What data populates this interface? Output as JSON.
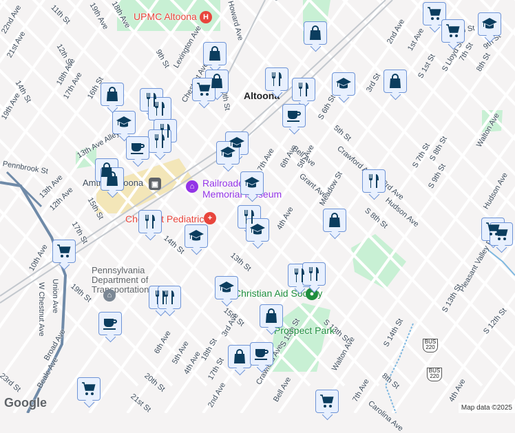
{
  "map": {
    "city_label": "Altoona",
    "pois": {
      "upmc": "UPMC Altoona",
      "railroad": "Railroaders Memorial Museum",
      "pediatrics": "Chestnut Pediatrics",
      "penndot": "Pennsylvania Department of Transportation...",
      "amtrak": "Amtrak Altoona",
      "aid": "Christian Aid Society",
      "park": "Prospect Park"
    },
    "streets": [
      "11th St",
      "19th Ave",
      "18th Ave",
      "Chestnut Ave",
      "Howard Ave",
      "9th St",
      "12th St",
      "21st Ave",
      "22nd Ave",
      "14th St",
      "18th Ave",
      "17th Ave",
      "16th St",
      "19th Ave",
      "Lexington Ave",
      "10th St",
      "Chestnut Ave",
      "13th Ave Alley",
      "Pennbrook St",
      "13th Ave",
      "12th Ave",
      "15th St",
      "17th St",
      "10th Ave",
      "14th St",
      "13th St",
      "19th St",
      "W Chestnut Ave",
      "Union Ave",
      "Broad Ave",
      "Beale Ave",
      "23rd St",
      "6th Ave",
      "5th Ave",
      "4th Ave",
      "18th St",
      "17th St",
      "20th St",
      "2nd Ave",
      "21st St",
      "15th St",
      "3rd Ave",
      "Crawford Ave",
      "Bell Ave",
      "S 15th St",
      "Walton Ave",
      "S 13th St",
      "7th Ave",
      "6th Ave",
      "5th Ave",
      "4th Ave",
      "3rd St",
      "2nd Ave",
      "1st Ave",
      "S 1st St",
      "S Lloyd St",
      "6th St",
      "7th St",
      "8th St",
      "9th St",
      "5th St",
      "Crawford Ave",
      "Bell Ave",
      "Grant Ave",
      "S 6th St",
      "S 7th St",
      "S 8th St",
      "Walton Ave",
      "3rd Ave",
      "Hudson Ave",
      "S 8th St",
      "S 9th St",
      "Meadow St",
      "Hudson Ave",
      "Pleasant Valley Blvd",
      "S 13th St",
      "S 12th St",
      "S 14th St",
      "7th Ave",
      "8th St",
      "4th Ave",
      "Carolina Ave"
    ],
    "route_shields": [
      "BUS 220",
      "BUS 220"
    ],
    "attribution": "Map data ©2025",
    "logo": "Google"
  },
  "markers": [
    "cart",
    "cart",
    "grad",
    "bag",
    "bag",
    "bag",
    "food",
    "food",
    "grad",
    "bag",
    "cart",
    "bag",
    "food",
    "food",
    "grad",
    "food",
    "food",
    "cafe",
    "grad",
    "grad",
    "cafe",
    "bag",
    "bag",
    "grad",
    "food",
    "food",
    "food",
    "grad",
    "grad",
    "bag",
    "cart",
    "cart",
    "cart",
    "food",
    "food",
    "grad",
    "food",
    "food",
    "bag",
    "cafe",
    "bag",
    "cafe",
    "cart",
    "cart"
  ],
  "colors": {
    "marker_fill": "#e8f0fe",
    "marker_border": "#6d93d6",
    "icon": "#0b3d5e",
    "park": "#c8f0d4",
    "rail": "#f3e6b8"
  }
}
